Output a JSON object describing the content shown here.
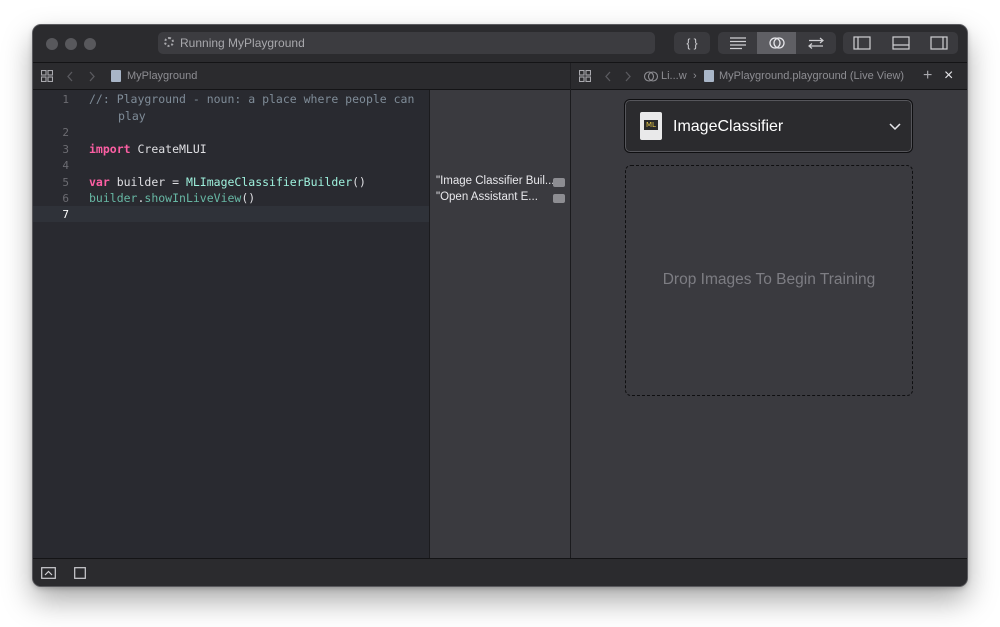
{
  "window": {
    "activity_text": "Running MyPlayground",
    "toolbar": {
      "library_label": "{ }"
    }
  },
  "editor_jumpbar": {
    "file_name": "MyPlayground"
  },
  "live_jumpbar": {
    "crumb_1": "Li...w",
    "crumb_separator": "›",
    "crumb_2": "MyPlayground.playground (Live View)",
    "add_label": "+",
    "close_label": "×"
  },
  "code": {
    "line_numbers": [
      "1",
      "2",
      "3",
      "4",
      "5",
      "6",
      "7"
    ],
    "line1": "//: Playground - noun: a place where people can",
    "line1_wrap": "play",
    "line3_kw": "import",
    "line3_rest": " CreateMLUI",
    "line5_kw": "var",
    "line5_mid": " builder = ",
    "line5_cls": "MLImageClassifierBuilder",
    "line5_end": "()",
    "line6_obj": "builder",
    "line6_dot": ".",
    "line6_fn": "showInLiveView",
    "line6_end": "()"
  },
  "results": [
    "\"Image Classifier Buil...",
    "\"Open Assistant E..."
  ],
  "live_view": {
    "popup_title": "ImageClassifier",
    "ml_icon_text": "ML",
    "drop_text": "Drop Images To Begin Training"
  },
  "icons": {
    "spinner": "progress-spinner-icon",
    "chevron_down": "chevron-down-icon",
    "grid": "grid-icon",
    "back": "chevron-left-icon",
    "forward": "chevron-right-icon"
  }
}
